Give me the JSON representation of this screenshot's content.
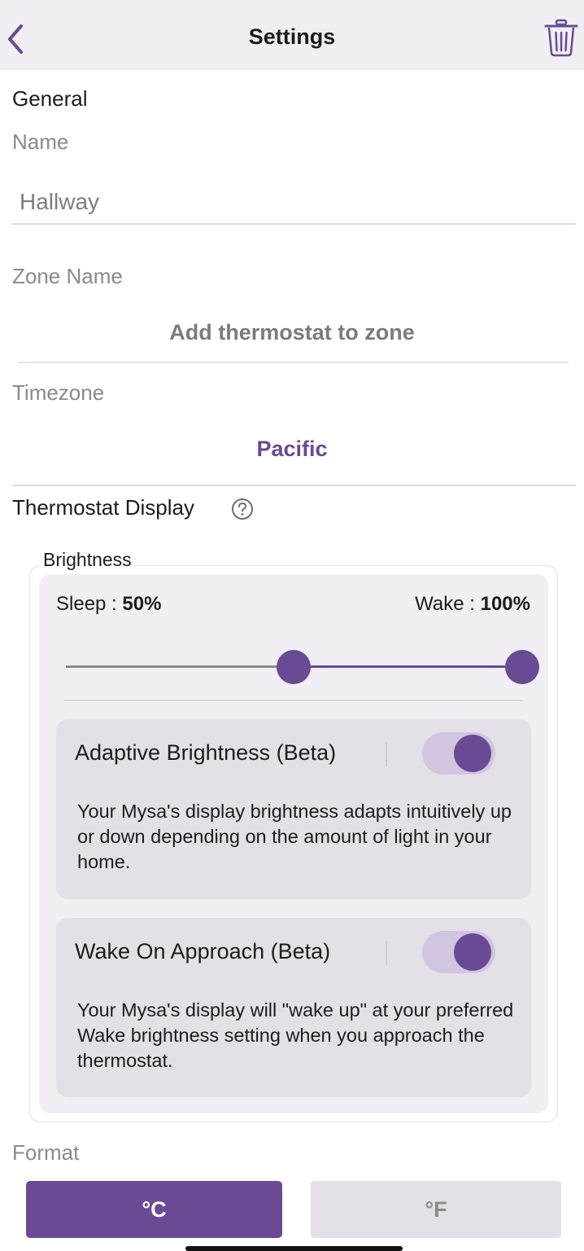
{
  "header": {
    "title": "Settings",
    "back_icon": "chevron-left-icon",
    "trash_icon": "trash-icon"
  },
  "general": {
    "section_title": "General",
    "name_label": "Name",
    "name_value": "Hallway",
    "zone_label": "Zone Name",
    "zone_action": "Add thermostat to zone",
    "timezone_label": "Timezone",
    "timezone_value": "Pacific"
  },
  "display": {
    "section_title": "Thermostat Display",
    "help_icon": "question-circle-icon",
    "brightness": {
      "legend": "Brightness",
      "sleep_label": "Sleep :",
      "sleep_value": "50%",
      "wake_label": "Wake :",
      "wake_value": "100%",
      "slider_sleep_fraction": 0.5,
      "slider_wake_fraction": 1.0
    },
    "adaptive": {
      "title": "Adaptive Brightness (Beta)",
      "enabled": true,
      "description": "Your Mysa's display brightness adapts intuitively up or down depending on the amount of light in your home."
    },
    "wake_on_approach": {
      "title": "Wake On Approach (Beta)",
      "enabled": true,
      "description": "Your Mysa's display will \"wake up\" at your preferred Wake brightness setting when you approach the thermostat."
    }
  },
  "format": {
    "label": "Format",
    "celsius": "°C",
    "fahrenheit": "°F",
    "selected": "celsius"
  },
  "colors": {
    "accent": "#6b4a95",
    "card_bg": "#f1eff4",
    "feature_bg": "#e3e1e7",
    "toggle_track": "#d1c5e0"
  }
}
